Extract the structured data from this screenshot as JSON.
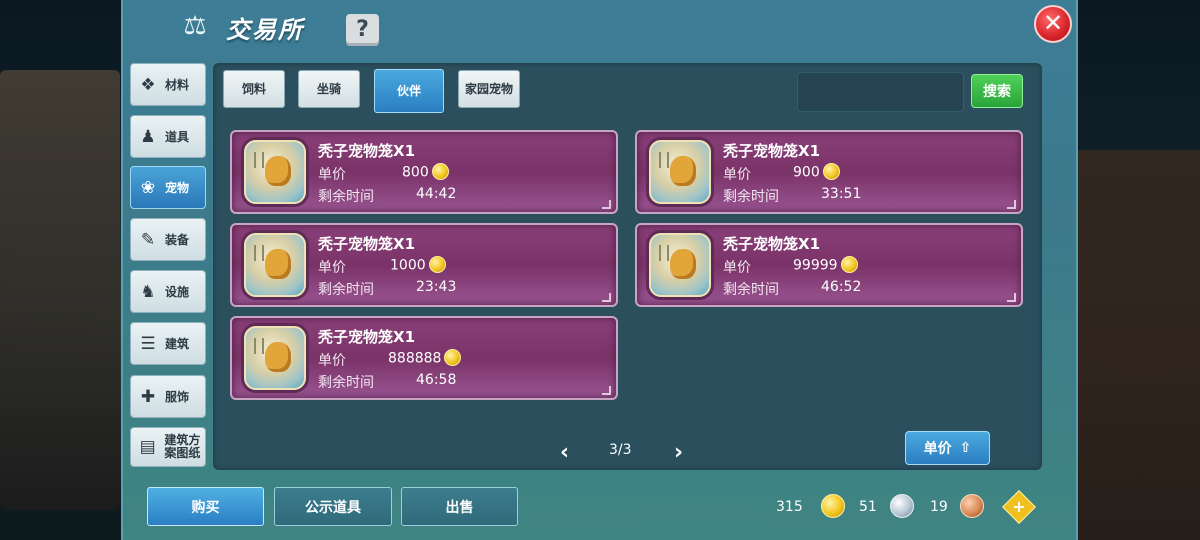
{
  "title": "交易所",
  "help_icon": "?",
  "close_icon": "✕",
  "categories": [
    {
      "label": "材料",
      "icon": "materials-icon"
    },
    {
      "label": "道具",
      "icon": "item-icon"
    },
    {
      "label": "宠物",
      "icon": "paw-icon"
    },
    {
      "label": "装备",
      "icon": "equipment-icon"
    },
    {
      "label": "设施",
      "icon": "facility-icon"
    },
    {
      "label": "建筑",
      "icon": "building-icon"
    },
    {
      "label": "服饰",
      "icon": "clothing-icon"
    },
    {
      "label": "建筑方案图纸",
      "icon": "blueprint-icon"
    }
  ],
  "active_category": "宠物",
  "subtabs": [
    {
      "label": "饲料"
    },
    {
      "label": "坐骑"
    },
    {
      "label": "伙伴"
    },
    {
      "label": "家园宠物"
    }
  ],
  "active_subtab": "伙伴",
  "search": {
    "value": "",
    "placeholder": "",
    "button_label": "搜索"
  },
  "labels": {
    "price": "单价",
    "time_left": "剩余时间"
  },
  "listings": [
    {
      "name": "秃子宠物笼X1",
      "price": "800",
      "time_left": "44:42"
    },
    {
      "name": "秃子宠物笼X1",
      "price": "900",
      "time_left": "33:51"
    },
    {
      "name": "秃子宠物笼X1",
      "price": "1000",
      "time_left": "23:43"
    },
    {
      "name": "秃子宠物笼X1",
      "price": "99999",
      "time_left": "46:52"
    },
    {
      "name": "秃子宠物笼X1",
      "price": "888888",
      "time_left": "46:58"
    }
  ],
  "pagination": {
    "text": "3/3",
    "prev": "‹",
    "next": "›"
  },
  "sort_button": {
    "label": "单价"
  },
  "bottom_tabs": [
    {
      "label": "购买"
    },
    {
      "label": "公示道具"
    },
    {
      "label": "出售"
    }
  ],
  "currency": {
    "gold": "315",
    "silver": "51",
    "bronze": "19"
  },
  "add_button": "+"
}
